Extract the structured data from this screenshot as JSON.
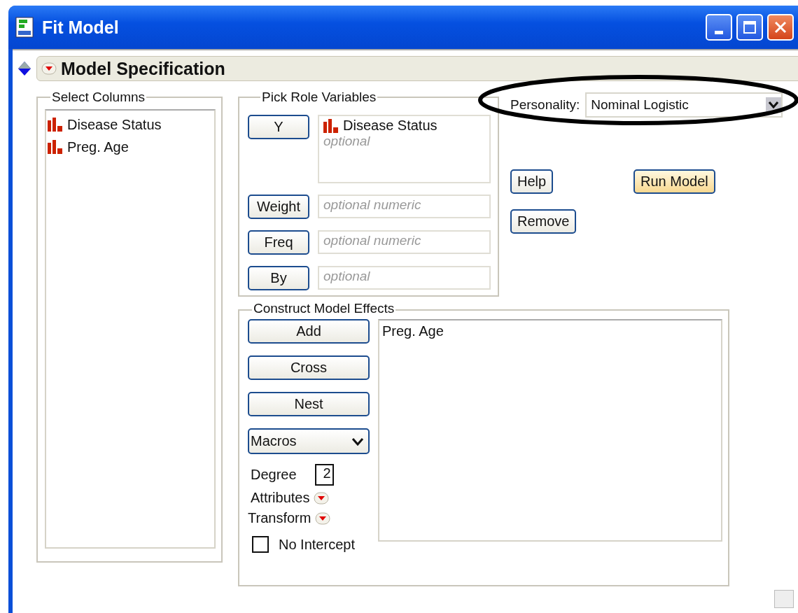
{
  "window": {
    "title": "Fit Model"
  },
  "header": {
    "title": "Model Specification"
  },
  "select_columns": {
    "title": "Select Columns",
    "items": [
      {
        "label": "Disease Status"
      },
      {
        "label": "Preg. Age"
      }
    ]
  },
  "roles": {
    "title": "Pick Role Variables",
    "rows": [
      {
        "button": "Y",
        "items": [
          "Disease Status"
        ],
        "placeholder": "optional"
      },
      {
        "button": "Weight",
        "items": [],
        "placeholder": "optional numeric"
      },
      {
        "button": "Freq",
        "items": [],
        "placeholder": "optional numeric"
      },
      {
        "button": "By",
        "items": [],
        "placeholder": "optional"
      }
    ]
  },
  "personality": {
    "label": "Personality:",
    "value": "Nominal Logistic"
  },
  "actions": [
    {
      "label": "Help",
      "kind": "normal"
    },
    {
      "label": "Run Model",
      "kind": "default"
    },
    {
      "label": "Remove",
      "kind": "normal"
    }
  ],
  "effects": {
    "title": "Construct Model Effects",
    "buttons": [
      "Add",
      "Cross",
      "Nest"
    ],
    "macros": "Macros",
    "degree": {
      "label": "Degree",
      "value": "2"
    },
    "attributes": "Attributes",
    "transform": "Transform",
    "no_intercept": {
      "label": "No Intercept",
      "checked": false
    },
    "items": [
      "Preg. Age"
    ]
  }
}
